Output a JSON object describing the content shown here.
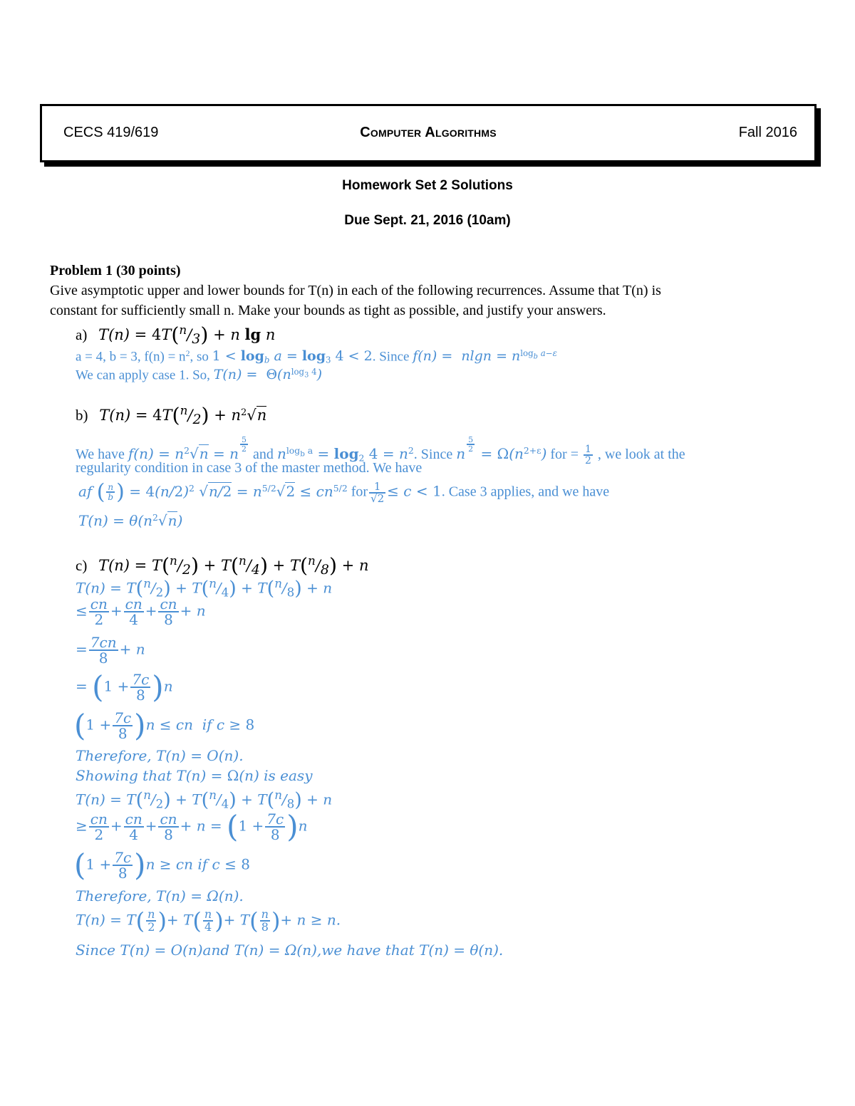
{
  "header": {
    "course_code": "CECS 419/619",
    "course_title": "Computer Algorithms",
    "term": "Fall 2016"
  },
  "title": "Homework Set 2 Solutions",
  "due": "Due Sept. 21, 2016 (10am)",
  "problem": {
    "heading": "Problem 1 (30 points)",
    "instructions_line1": "Give asymptotic upper and lower bounds for T(n) in each of the following recurrences. Assume that T(n) is",
    "instructions_line2": "constant for sufficiently small n. Make your bounds as tight as possible, and justify your answers.",
    "colors": {
      "solution": "#4a8fd4",
      "text": "#000000"
    },
    "parts": [
      {
        "label": "a)",
        "recurrence": "T(n) = 4T(n/3) + n lg n",
        "solution_lines": [
          "a = 4, b = 3, f(n) = n², so 1 < log_b a = log_3 4 < 2. Since f(n) = nlgn = n^(log_b a − ε)",
          "We can apply case 1. So, T(n) = Θ(n^(log_3 4))"
        ]
      },
      {
        "label": "b)",
        "recurrence": "T(n) = 4T(n/2) + n²√n",
        "solution_lines": [
          "We have f(n) = n²√n = n^(5/2) and n^(log_b a) = log_2 4 = n². Since n^(5/2) = Ω(n^(2+ε)) for = 1/2 , we look at the",
          "regularity condition in case 3 of the master method. We have",
          "af(n/b) = 4(n/2)² √(n/2) = n^(5/2)√2 ≤ cn^(5/2) for 1/√2 ≤ c < 1. Case 3 applies, and we have",
          "T(n) = θ(n²√n)"
        ]
      },
      {
        "label": "c)",
        "recurrence": "T(n) = T(n/2) + T(n/4) + T(n/8) + n",
        "solution_lines": [
          "T(n) = T(n/2) + T(n/4) + T(n/8) + n",
          "≤ cn/2 + cn/4 + cn/8 + n",
          "= 7cn/8 + n",
          "= (1 + 7c/8) n",
          "(1 + 7c/8) n ≤ cn if c ≥ 8",
          "Therefore, T(n) = O(n).",
          "Showing that T(n) = Ω(n) is easy",
          "T(n) = T(n/2) + T(n/4) + T(n/8) + n",
          "≥ cn/2 + cn/4 + cn/8 + n = (1 + 7c/8) n",
          "(1 + 7c/8) n ≥ cn if c ≤ 8",
          "Therefore, T(n) = Ω(n).",
          "T(n) = T(n/2) + T(n/4) + T(n/8) + n ≥ n.",
          "Since T(n) = O(n) and T(n) = Ω(n), we have that T(n) = θ(n)."
        ]
      }
    ],
    "tokens": {
      "T": "T",
      "n": "n",
      "c": "c",
      "cn": "cn",
      "7cn": "7cn",
      "7c": "7c",
      "one": "1",
      "two": "2",
      "three": "3",
      "four": "4",
      "five": "5",
      "eight": "8",
      "eq": "=",
      "plus": "+",
      "le": "≤",
      "ge": "≥",
      "lt": "<",
      "lg": "lg",
      "log": "log",
      "b": "b",
      "a": "a",
      "eps": "ε",
      "Theta": "Θ",
      "theta": "θ",
      "Omega": "Ω",
      "O": "O",
      "f": "f",
      "sqrt": "√",
      "lp": "(",
      "rp": ")",
      "slash": "/",
      "if": "if",
      "sq": "2",
      "two_eps": "2+ε",
      "five_half": "5/2",
      "therefore": "Therefore,",
      "showing": "Showing that",
      "is_easy": "is easy",
      "since": "Since",
      "and": "and",
      "we_have_that": "we have that",
      "period": ".",
      "comma": ",",
      "4T": "4T",
      "nlgn": "nlgn",
      "a_line_pre": "a = 4, b = 3, f(n) = n",
      "a_line_so": ", so ",
      "a_line_since": ". Since ",
      "a_line2_pre": "We can apply case 1. So, ",
      "b_we_have": "We have ",
      "b_and": "and ",
      "b_since": ". Since ",
      "b_for": "for ",
      "b_tail": ", we look at the",
      "b_line2": "regularity condition in case 3 of the master method. We have",
      "b_for2": "for",
      "b_case3": ". Case 3 applies, and we have"
    }
  }
}
